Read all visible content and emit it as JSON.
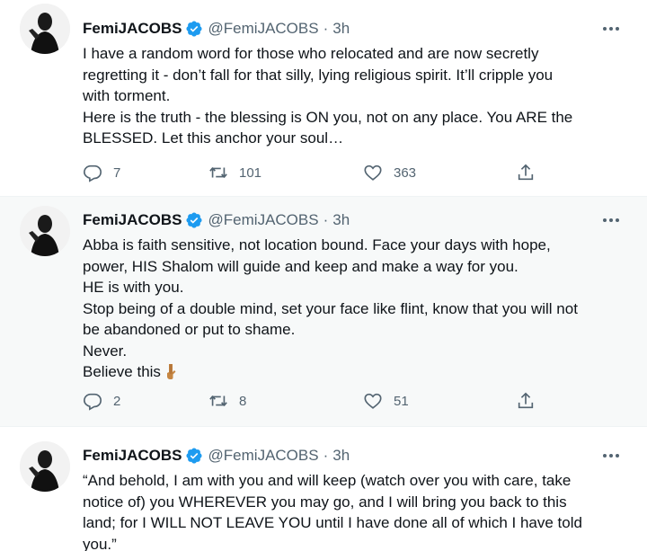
{
  "tweets": [
    {
      "author": {
        "name": "FemiJACOBS",
        "handle": "@FemiJACOBS",
        "separator": "·",
        "time": "3h"
      },
      "lines": [
        "I have a random word for those who relocated and are now secretly",
        "regretting it - don’t fall for that silly, lying religious spirit. It’ll cripple you",
        "with torment.",
        "Here is the truth - the blessing is ON you, not on any place. You ARE the",
        "BLESSED. Let this anchor your soul…"
      ],
      "stats": {
        "replies": "7",
        "retweets": "101",
        "likes": "363"
      }
    },
    {
      "author": {
        "name": "FemiJACOBS",
        "handle": "@FemiJACOBS",
        "separator": "·",
        "time": "3h"
      },
      "lines": [
        "Abba is faith sensitive, not location bound. Face your days with hope,",
        "power, HIS Shalom will guide and keep and make a way for you.",
        "HE is with you.",
        "Stop being of a double mind, set your face like flint, know that you will not",
        "be abandoned or put to shame.",
        "Never.",
        "Believe this"
      ],
      "stats": {
        "replies": "2",
        "retweets": "8",
        "likes": "51"
      }
    },
    {
      "author": {
        "name": "FemiJACOBS",
        "handle": "@FemiJACOBS",
        "separator": "·",
        "time": "3h"
      },
      "lines": [
        "“And behold, I am with you and will keep (watch over you with care, take",
        "notice of) you WHEREVER you may go, and I will bring you back to this",
        "land; for I WILL NOT LEAVE YOU until I have done all of which I have told",
        "you.”"
      ]
    }
  ],
  "icons": {
    "verified": "verified-badge-icon",
    "more": "more-options-icon",
    "reply": "reply-icon",
    "retweet": "retweet-icon",
    "like": "heart-icon",
    "share": "share-icon",
    "emoji": "backhand-index-pointing-down-emoji"
  },
  "colors": {
    "text": "#0f1419",
    "secondary": "#536471",
    "verified": "#1d9bf0",
    "hover_bg": "#f7f9f9",
    "divider": "#eff3f4"
  }
}
